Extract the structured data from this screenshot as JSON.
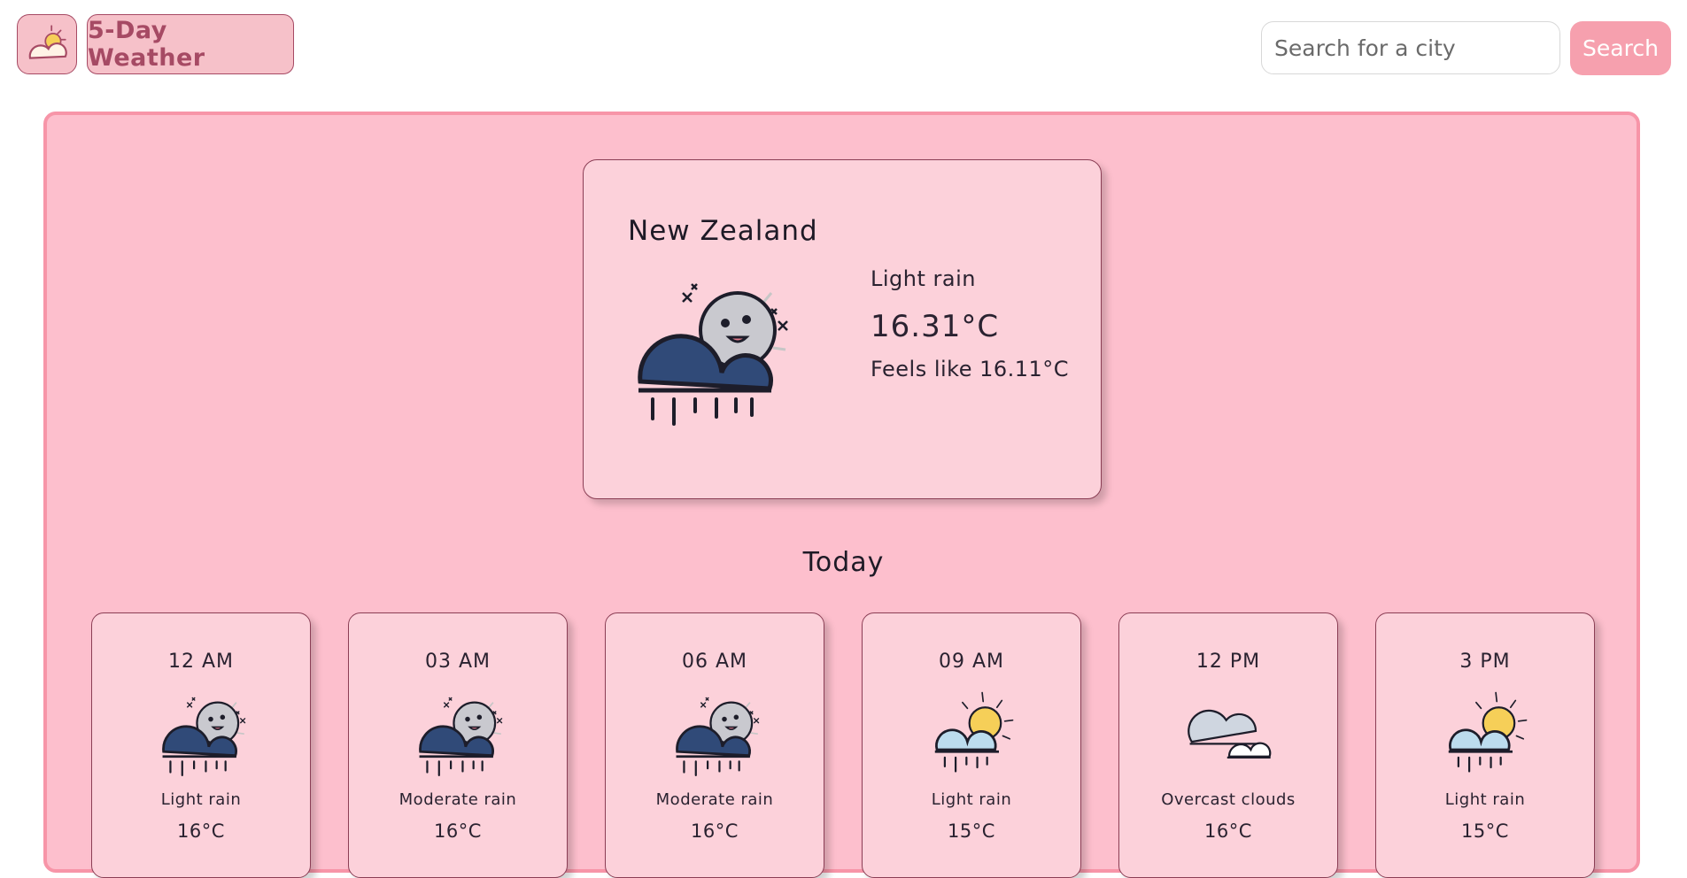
{
  "header": {
    "logo_icon": "sun-cloud-icon",
    "brand": "5-Day Weather"
  },
  "search": {
    "placeholder": "Search for a city",
    "value": "",
    "button_label": "Search"
  },
  "current": {
    "city": "New Zealand",
    "icon": "night-rain-icon",
    "condition": "Light rain",
    "temperature": "16.31°C",
    "feels_like": "Feels like 16.11°C"
  },
  "today": {
    "heading": "Today",
    "hours": [
      {
        "time": "12 AM",
        "icon": "night-rain-icon",
        "description": "Light rain",
        "temp": "16°C"
      },
      {
        "time": "03 AM",
        "icon": "night-rain-icon",
        "description": "Moderate rain",
        "temp": "16°C"
      },
      {
        "time": "06 AM",
        "icon": "night-rain-icon",
        "description": "Moderate rain",
        "temp": "16°C"
      },
      {
        "time": "09 AM",
        "icon": "day-rain-icon",
        "description": "Light rain",
        "temp": "15°C"
      },
      {
        "time": "12 PM",
        "icon": "overcast-clouds-icon",
        "description": "Overcast clouds",
        "temp": "16°C"
      },
      {
        "time": "3 PM",
        "icon": "day-rain-icon",
        "description": "Light rain",
        "temp": "15°C"
      }
    ]
  },
  "colors": {
    "panel_bg": "#fdbfcd",
    "card_bg": "#fcd1da",
    "accent": "#f6a0ae",
    "brand_text": "#a64a64"
  }
}
